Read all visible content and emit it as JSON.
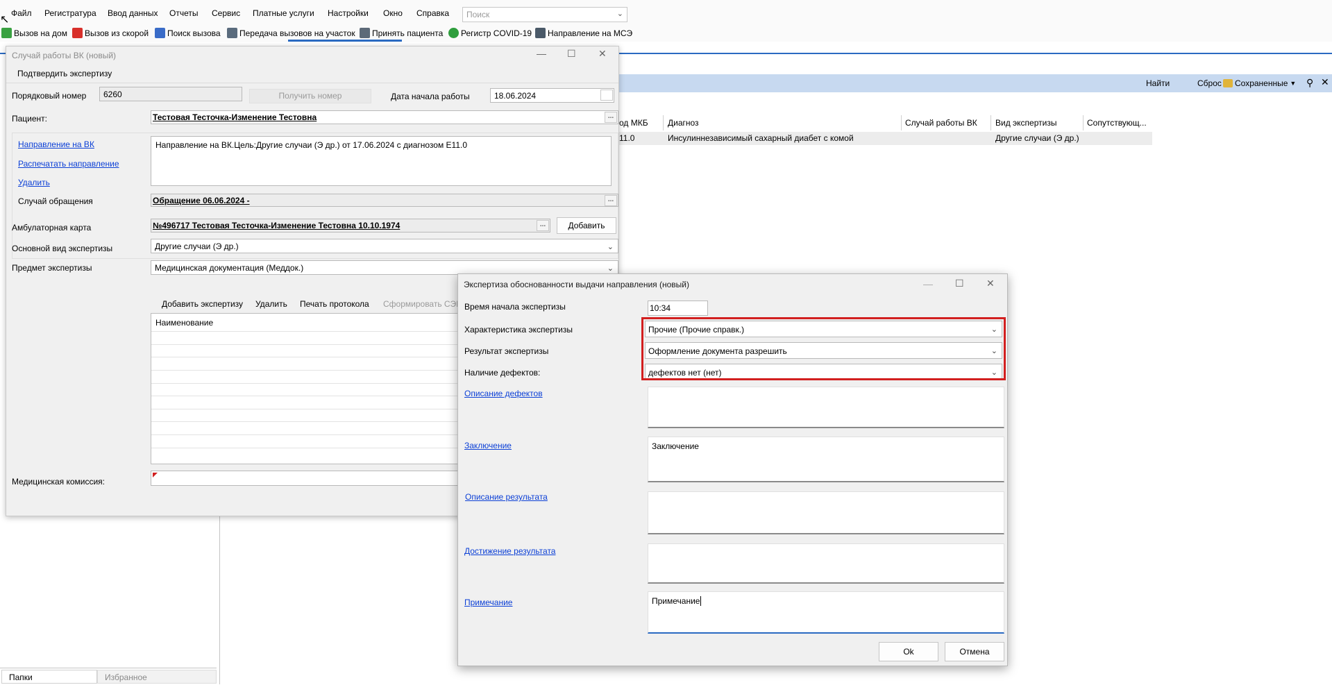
{
  "menu": [
    "Файл",
    "Регистратура",
    "Ввод данных",
    "Отчеты",
    "Сервис",
    "Платные услуги",
    "Настройки",
    "Окно",
    "Справка"
  ],
  "search": {
    "placeholder": "Поиск"
  },
  "toolbar": [
    {
      "label": "Вызов на дом",
      "icon": "house-call-icon",
      "color": "#3aa142"
    },
    {
      "label": "Вызов из скорой",
      "icon": "ambulance-icon",
      "color": "#d8302b"
    },
    {
      "label": "Поиск вызова",
      "icon": "search-call-icon",
      "color": "#3a6cc8"
    },
    {
      "label": "Передача вызовов на участок",
      "icon": "transfer-icon",
      "color": "#5a6b7d"
    },
    {
      "label": "Принять пациента",
      "icon": "accept-patient-icon",
      "color": "#5d6a78"
    },
    {
      "label": "Регистр COVID-19",
      "icon": "covid-icon",
      "color": "#2f9e3d"
    },
    {
      "label": "Направление на МСЭ",
      "icon": "mse-icon",
      "color": "#4a5968"
    }
  ],
  "bg": {
    "header_buttons": [
      "Найти",
      "Сброс",
      "Сохраненные"
    ],
    "columns": [
      "од МКБ",
      "Диагноз",
      "Случай работы ВК",
      "Вид экспертизы",
      "Сопутствующ..."
    ],
    "row": [
      "11.0",
      "Инсулиннезависимый сахарный диабет с комой",
      "",
      "Другие случаи (Э др.)",
      ""
    ],
    "bottom_tabs": [
      "Папки",
      "Избранное"
    ]
  },
  "win1": {
    "title": "Случай работы ВК (новый)",
    "confirm": "Подтвердить экспертизу",
    "seq_label": "Порядковый номер",
    "seq_value": "6260",
    "get_number": "Получить номер",
    "start_date_label": "Дата начала работы",
    "start_date_value": "18.06.2024",
    "patient_label": "Пациент:",
    "patient_value": "Тестовая Тесточка-Изменение Тестовна",
    "link_direction": "Направление на ВК",
    "link_print": "Распечатать направление",
    "link_delete": "Удалить",
    "direction_text": "Направление на ВК.Цель:Другие случаи (Э др.) от 17.06.2024 с диагнозом E11.0",
    "case_label": "Случай обращения",
    "case_value": "Обращение 06.06.2024 -",
    "card_label": "Амбулаторная карта",
    "card_value": "№496717 Тестовая Тесточка-Изменение Тестовна 10.10.1974",
    "add_button": "Добавить",
    "main_kind_label": "Основной вид экспертизы",
    "main_kind_value": "Другие случаи (Э др.)",
    "subject_label": "Предмет экспертизы",
    "subject_value": "Медицинская документация (Меддок.)",
    "grid_toolbar": [
      "Добавить экспертизу",
      "Удалить",
      "Печать протокола",
      "Сформировать СЭМ"
    ],
    "grid_header": "Наименование",
    "commission_label": "Медицинская комиссия:"
  },
  "win2": {
    "title": "Экспертиза обоснованности выдачи направления (новый)",
    "time_label": "Время начала экспертизы",
    "time_value": "10:34",
    "char_label": "Характеристика экспертизы",
    "char_value": "Прочие (Прочие справк.)",
    "result_label": "Результат экспертизы",
    "result_value": "Оформление документа разрешить",
    "defects_label": "Наличие дефектов:",
    "defects_value": "дефектов нет (нет)",
    "defects_desc_link": "Описание дефектов",
    "conclusion_link": "Заключение",
    "conclusion_value": "Заключение",
    "result_desc_link": "Описание результата",
    "achievement_link": "Достижение результата",
    "note_link": "Примечание",
    "note_value": "Примечание",
    "ok": "Ok",
    "cancel": "Отмена"
  }
}
